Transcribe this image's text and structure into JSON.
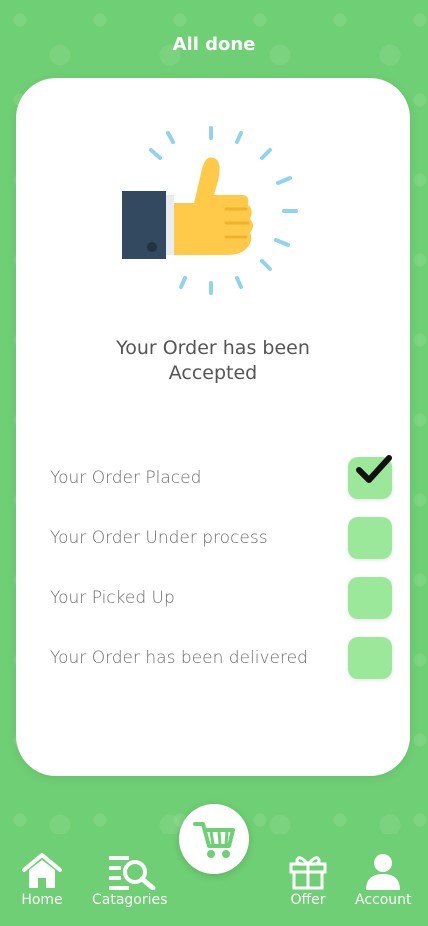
{
  "header": {
    "title": "All done"
  },
  "message": {
    "line1": "Your Order  has been",
    "line2": "Accepted"
  },
  "steps": [
    {
      "label": "Your Order Placed",
      "checked": true
    },
    {
      "label": "Your Order Under process",
      "checked": false
    },
    {
      "label": "Your Picked Up",
      "checked": false
    },
    {
      "label": "Your Order has been delivered",
      "checked": false
    }
  ],
  "nav": {
    "home": "Home",
    "categories": "Catagories",
    "offer": "Offer",
    "account": "Account"
  },
  "icons": {
    "thumbs_up": "thumbs-up-icon",
    "check": "check-icon",
    "cart": "cart-icon",
    "home": "home-icon",
    "categories": "search-list-icon",
    "offer": "gift-icon",
    "account": "user-icon"
  },
  "colors": {
    "background": "#6fcf74",
    "step_box": "#9be89b",
    "thumb_yellow": "#ffc94a",
    "sleeve": "#33495f",
    "rays": "#8fd3ef"
  }
}
